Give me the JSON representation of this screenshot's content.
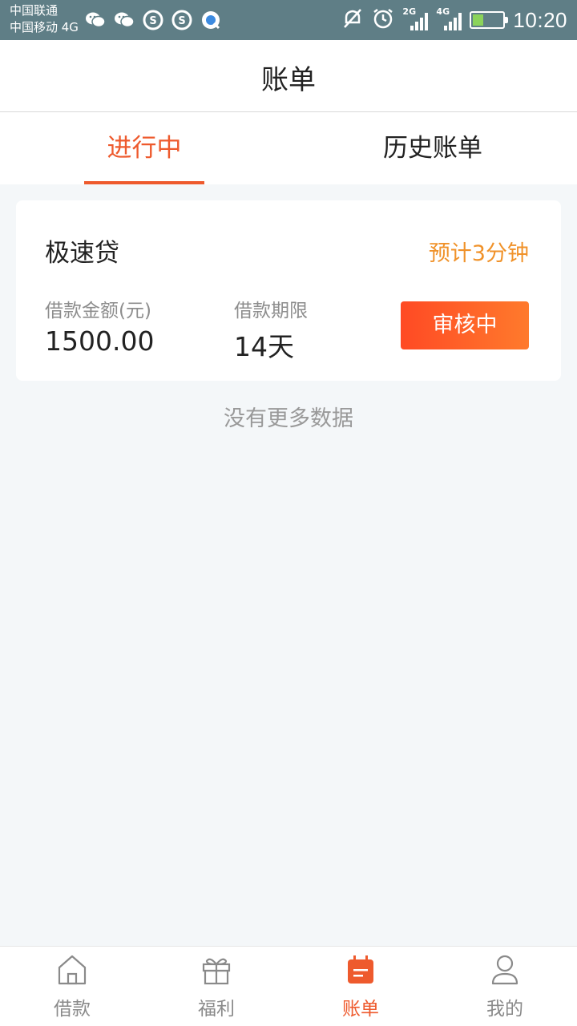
{
  "status_bar": {
    "carrier1": "中国联通",
    "carrier2": "中国移动 4G",
    "net1": "2G",
    "net2": "4G",
    "time": "10:20",
    "battery_level": 0.35,
    "icons": [
      "wechat-icon",
      "wechat-icon",
      "sogou-icon",
      "sogou-icon",
      "browser-icon",
      "mute-icon",
      "alarm-icon"
    ]
  },
  "header": {
    "title": "账单"
  },
  "tabs": [
    {
      "label": "进行中",
      "active": true
    },
    {
      "label": "历史账单",
      "active": false
    }
  ],
  "loan_card": {
    "product_name": "极速贷",
    "eta": "预计3分钟",
    "amount_label": "借款金额(元)",
    "amount_value": "1500.00",
    "term_label": "借款期限",
    "term_value": "14天",
    "status_label": "审核中"
  },
  "no_more_text": "没有更多数据",
  "bottom_nav": [
    {
      "label": "借款",
      "icon": "home-icon",
      "active": false
    },
    {
      "label": "福利",
      "icon": "gift-icon",
      "active": false
    },
    {
      "label": "账单",
      "icon": "bill-icon",
      "active": true
    },
    {
      "label": "我的",
      "icon": "profile-icon",
      "active": false
    }
  ],
  "colors": {
    "accent": "#ee5a2d",
    "eta": "#f0922a",
    "status_bar": "#5f7e86",
    "page_bg": "#f4f7f9"
  }
}
